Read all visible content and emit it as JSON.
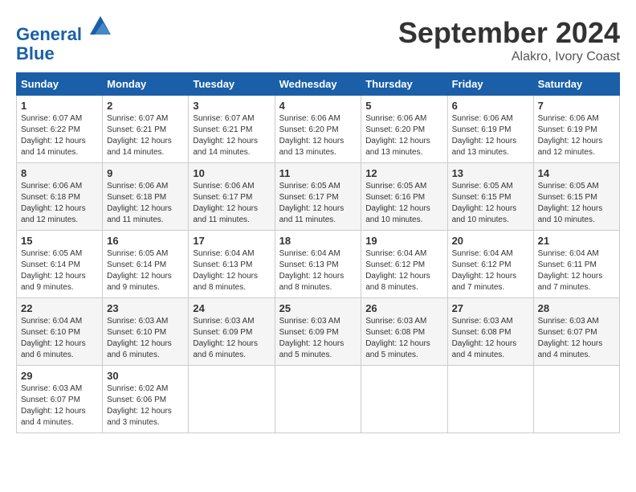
{
  "logo": {
    "line1": "General",
    "line2": "Blue"
  },
  "title": "September 2024",
  "location": "Alakro, Ivory Coast",
  "weekdays": [
    "Sunday",
    "Monday",
    "Tuesday",
    "Wednesday",
    "Thursday",
    "Friday",
    "Saturday"
  ],
  "weeks": [
    [
      {
        "day": "1",
        "sunrise": "6:07 AM",
        "sunset": "6:22 PM",
        "daylight": "12 hours and 14 minutes."
      },
      {
        "day": "2",
        "sunrise": "6:07 AM",
        "sunset": "6:21 PM",
        "daylight": "12 hours and 14 minutes."
      },
      {
        "day": "3",
        "sunrise": "6:07 AM",
        "sunset": "6:21 PM",
        "daylight": "12 hours and 14 minutes."
      },
      {
        "day": "4",
        "sunrise": "6:06 AM",
        "sunset": "6:20 PM",
        "daylight": "12 hours and 13 minutes."
      },
      {
        "day": "5",
        "sunrise": "6:06 AM",
        "sunset": "6:20 PM",
        "daylight": "12 hours and 13 minutes."
      },
      {
        "day": "6",
        "sunrise": "6:06 AM",
        "sunset": "6:19 PM",
        "daylight": "12 hours and 13 minutes."
      },
      {
        "day": "7",
        "sunrise": "6:06 AM",
        "sunset": "6:19 PM",
        "daylight": "12 hours and 12 minutes."
      }
    ],
    [
      {
        "day": "8",
        "sunrise": "6:06 AM",
        "sunset": "6:18 PM",
        "daylight": "12 hours and 12 minutes."
      },
      {
        "day": "9",
        "sunrise": "6:06 AM",
        "sunset": "6:18 PM",
        "daylight": "12 hours and 11 minutes."
      },
      {
        "day": "10",
        "sunrise": "6:06 AM",
        "sunset": "6:17 PM",
        "daylight": "12 hours and 11 minutes."
      },
      {
        "day": "11",
        "sunrise": "6:05 AM",
        "sunset": "6:17 PM",
        "daylight": "12 hours and 11 minutes."
      },
      {
        "day": "12",
        "sunrise": "6:05 AM",
        "sunset": "6:16 PM",
        "daylight": "12 hours and 10 minutes."
      },
      {
        "day": "13",
        "sunrise": "6:05 AM",
        "sunset": "6:15 PM",
        "daylight": "12 hours and 10 minutes."
      },
      {
        "day": "14",
        "sunrise": "6:05 AM",
        "sunset": "6:15 PM",
        "daylight": "12 hours and 10 minutes."
      }
    ],
    [
      {
        "day": "15",
        "sunrise": "6:05 AM",
        "sunset": "6:14 PM",
        "daylight": "12 hours and 9 minutes."
      },
      {
        "day": "16",
        "sunrise": "6:05 AM",
        "sunset": "6:14 PM",
        "daylight": "12 hours and 9 minutes."
      },
      {
        "day": "17",
        "sunrise": "6:04 AM",
        "sunset": "6:13 PM",
        "daylight": "12 hours and 8 minutes."
      },
      {
        "day": "18",
        "sunrise": "6:04 AM",
        "sunset": "6:13 PM",
        "daylight": "12 hours and 8 minutes."
      },
      {
        "day": "19",
        "sunrise": "6:04 AM",
        "sunset": "6:12 PM",
        "daylight": "12 hours and 8 minutes."
      },
      {
        "day": "20",
        "sunrise": "6:04 AM",
        "sunset": "6:12 PM",
        "daylight": "12 hours and 7 minutes."
      },
      {
        "day": "21",
        "sunrise": "6:04 AM",
        "sunset": "6:11 PM",
        "daylight": "12 hours and 7 minutes."
      }
    ],
    [
      {
        "day": "22",
        "sunrise": "6:04 AM",
        "sunset": "6:10 PM",
        "daylight": "12 hours and 6 minutes."
      },
      {
        "day": "23",
        "sunrise": "6:03 AM",
        "sunset": "6:10 PM",
        "daylight": "12 hours and 6 minutes."
      },
      {
        "day": "24",
        "sunrise": "6:03 AM",
        "sunset": "6:09 PM",
        "daylight": "12 hours and 6 minutes."
      },
      {
        "day": "25",
        "sunrise": "6:03 AM",
        "sunset": "6:09 PM",
        "daylight": "12 hours and 5 minutes."
      },
      {
        "day": "26",
        "sunrise": "6:03 AM",
        "sunset": "6:08 PM",
        "daylight": "12 hours and 5 minutes."
      },
      {
        "day": "27",
        "sunrise": "6:03 AM",
        "sunset": "6:08 PM",
        "daylight": "12 hours and 4 minutes."
      },
      {
        "day": "28",
        "sunrise": "6:03 AM",
        "sunset": "6:07 PM",
        "daylight": "12 hours and 4 minutes."
      }
    ],
    [
      {
        "day": "29",
        "sunrise": "6:03 AM",
        "sunset": "6:07 PM",
        "daylight": "12 hours and 4 minutes."
      },
      {
        "day": "30",
        "sunrise": "6:02 AM",
        "sunset": "6:06 PM",
        "daylight": "12 hours and 3 minutes."
      },
      null,
      null,
      null,
      null,
      null
    ]
  ]
}
